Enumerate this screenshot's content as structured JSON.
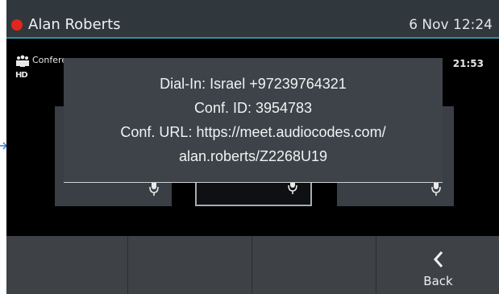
{
  "topbar": {
    "user_name": "Alan Roberts",
    "datetime": "6 Nov 12:24",
    "status_color": "#e1261c"
  },
  "call": {
    "type_label": "Conference",
    "hd_label": "HD",
    "elapsed": "21:53"
  },
  "popup": {
    "lines": [
      "Dial-In: Israel +97239764321",
      "Conf. ID: 3954783",
      "Conf. URL: https://meet.audiocodes.com/",
      "alan.roberts/Z2268U19"
    ]
  },
  "softkeys": {
    "back_label": "Back"
  },
  "icons": {
    "presence": "presence-dot-icon",
    "conference": "conference-icon",
    "hd": "hd-icon",
    "mic": "microphone-icon",
    "back": "chevron-left-icon",
    "pointer": "arrow-pointer-icon"
  },
  "colors": {
    "accent": "#2f8ea6",
    "popup_bg": "#3d4349",
    "softkey_bg": "#3e4247"
  }
}
